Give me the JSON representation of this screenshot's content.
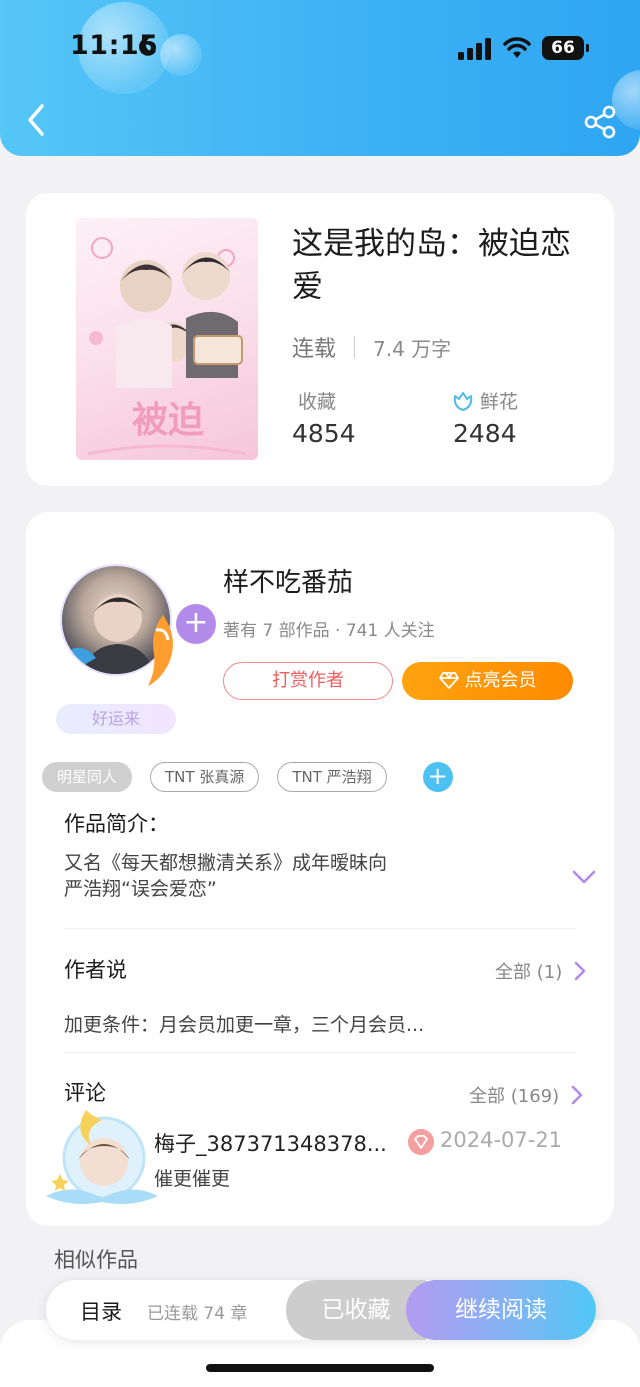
{
  "status_bar": {
    "time": "11:15",
    "battery": "66"
  },
  "colors": {
    "header_blue": "#3cb0f5",
    "accent_purple": "#b28bea",
    "reward_red": "#ef5d5d",
    "vip_orange": "#ff9a05"
  },
  "book": {
    "title": "这是我的岛：被迫恋爱",
    "status": "连载",
    "word_count": "7.4 万字",
    "favorites_label": "收藏",
    "favorites_value": "4854",
    "flowers_label": "鲜花",
    "flowers_value": "2484"
  },
  "author": {
    "name": "样不吃番茄",
    "info": "著有 7 部作品 · 741 人关注",
    "luck_tag": "好运来",
    "reward_button": "打赏作者",
    "vip_button": "点亮会员"
  },
  "tags": [
    "明星同人",
    "TNT 张真源",
    "TNT 严浩翔"
  ],
  "intro": {
    "title": "作品简介：",
    "line1": "又名《每天都想撇清关系》成年暧昧向",
    "line2": "严浩翔“误会爱恋”"
  },
  "author_say": {
    "title": "作者说",
    "all_link": "全部 (1)",
    "text": "加更条件：月会员加更一章，三个月会员..."
  },
  "comments": {
    "title": "评论",
    "all_link": "全部 (169)",
    "first": {
      "user": "梅子_387371348378...",
      "date": "2024-07-21",
      "text": "催更催更"
    }
  },
  "similar_title": "相似作品",
  "bottom_bar": {
    "toc": "目录",
    "chapters": "已连载 74 章",
    "collected": "已收藏",
    "continue": "继续阅读"
  }
}
